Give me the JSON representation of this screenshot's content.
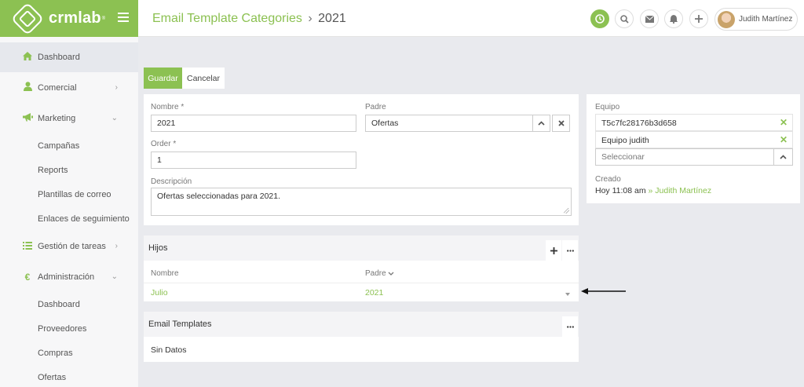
{
  "app": {
    "logo_text": "crmlab",
    "logo_reg": "®"
  },
  "header": {
    "title_parent": "Email Template Categories",
    "separator": "›",
    "title_current": "2021",
    "user_name": "Judith Martínez"
  },
  "sidebar": {
    "items": [
      {
        "label": "Dashboard",
        "icon": "home-icon"
      },
      {
        "label": "Comercial",
        "icon": "user-icon"
      },
      {
        "label": "Marketing",
        "icon": "megaphone-icon"
      },
      {
        "label": "Campañas"
      },
      {
        "label": "Reports"
      },
      {
        "label": "Plantillas de correo"
      },
      {
        "label": "Enlaces de seguimiento"
      },
      {
        "label": "Gestión de tareas",
        "icon": "tasks-icon"
      },
      {
        "label": "Administración",
        "icon": "euro-icon",
        "icon_glyph": "€"
      },
      {
        "label": "Dashboard"
      },
      {
        "label": "Proveedores"
      },
      {
        "label": "Compras"
      },
      {
        "label": "Ofertas"
      }
    ]
  },
  "actions": {
    "save": "Guardar",
    "cancel": "Cancelar"
  },
  "form": {
    "nombre_label": "Nombre *",
    "nombre_value": "2021",
    "padre_label": "Padre",
    "padre_value": "Ofertas",
    "order_label": "Order *",
    "order_value": "1",
    "descripcion_label": "Descripción",
    "descripcion_value": "Ofertas seleccionadas para 2021."
  },
  "side_panel": {
    "equipo_label": "Equipo",
    "teams": [
      "T5c7fc28176b3d658",
      "Equipo judith"
    ],
    "select_placeholder": "Seleccionar",
    "creado_label": "Creado",
    "creado_time": "Hoy 11:08 am",
    "creado_sep": "»",
    "creado_user": "Judith Martínez"
  },
  "hijos": {
    "title": "Hijos",
    "col_nombre": "Nombre",
    "col_padre": "Padre",
    "rows": [
      {
        "nombre": "Julio",
        "padre": "2021"
      }
    ]
  },
  "email_templates": {
    "title": "Email Templates",
    "empty": "Sin Datos"
  },
  "colors": {
    "accent": "#8cc152",
    "background": "#e9eaee"
  }
}
